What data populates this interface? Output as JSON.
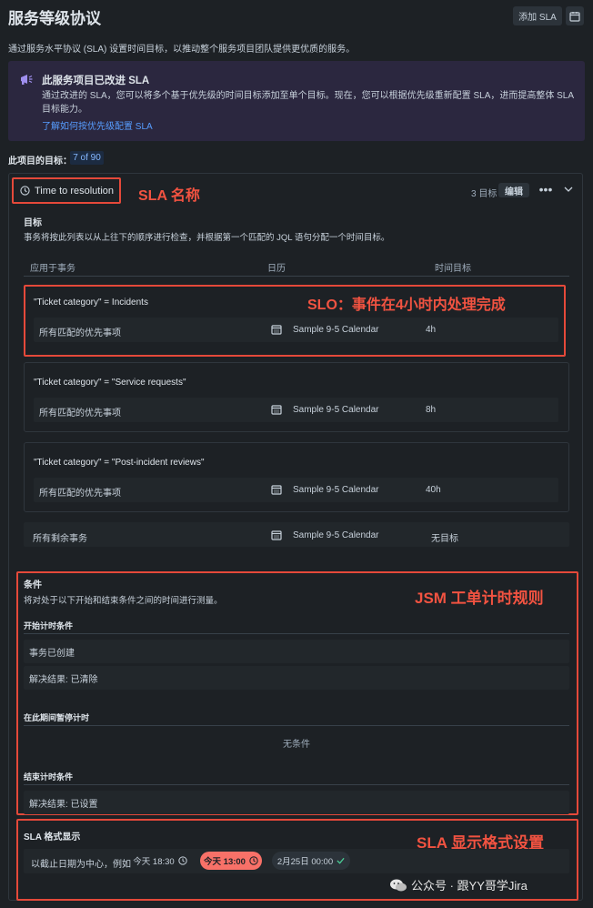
{
  "header": {
    "title": "服务等级协议",
    "add_sla_label": "添加 SLA",
    "subtitle": "通过服务水平协议 (SLA) 设置时间目标，以推动整个服务项目团队提供更优质的服务。"
  },
  "banner": {
    "title": "此服务项目已改进 SLA",
    "body": "通过改进的 SLA，您可以将多个基于优先级的时间目标添加至单个目标。现在，您可以根据优先级重新配置 SLA，进而提高整体 SLA 目标能力。",
    "link": "了解如何按优先级配置 SLA"
  },
  "goals_summary": {
    "label": "此项目的目标：",
    "count": "7 of 90"
  },
  "sla": {
    "name": "Time to resolution",
    "goals_count": "3 目标",
    "edit_label": "编辑",
    "goals_section": {
      "heading": "目标",
      "description": "事务将按此列表以从上往下的顺序进行检查，并根据第一个匹配的 JQL 语句分配一个时间目标。",
      "columns": [
        "应用于事务",
        "日历",
        "时间目标"
      ],
      "blocks": [
        {
          "jql": "\"Ticket category\" = Incidents",
          "row_label": "所有匹配的优先事项",
          "calendar": "Sample 9-5 Calendar",
          "target": "4h"
        },
        {
          "jql": "\"Ticket category\" = \"Service requests\"",
          "row_label": "所有匹配的优先事项",
          "calendar": "Sample 9-5 Calendar",
          "target": "8h"
        },
        {
          "jql": "\"Ticket category\" = \"Post-incident reviews\"",
          "row_label": "所有匹配的优先事项",
          "calendar": "Sample 9-5 Calendar",
          "target": "40h"
        }
      ],
      "remaining": {
        "label": "所有剩余事务",
        "calendar": "Sample 9-5 Calendar",
        "target": "无目标"
      }
    },
    "conditions": {
      "heading": "条件",
      "description": "将对处于以下开始和结束条件之间的时间进行测量。",
      "start_label": "开始计时条件",
      "start_items": [
        "事务已创建",
        "解决结果: 已清除"
      ],
      "pause_label": "在此期间暂停计时",
      "pause_empty": "无条件",
      "stop_label": "结束计时条件",
      "stop_items": [
        "解决结果: 已设置"
      ]
    },
    "format": {
      "heading": "SLA 格式显示",
      "option_label": "以截止日期为中心，例如",
      "example_1": "今天 18:30",
      "example_2": "今天 13:00",
      "example_3": "2月25日 00:00"
    }
  },
  "annotations": {
    "sla_name": "SLA 名称",
    "slo": "SLO：事件在4小时内处理完成",
    "jsm_rule": "JSM 工单计时规则",
    "format": "SLA 显示格式设置"
  },
  "watermark": "公众号 · 跟YY哥学Jira",
  "colors": {
    "background": "#1d2125",
    "annotation_red": "#e5493a",
    "link_blue": "#579dff",
    "banner_purple": "#2b273f",
    "overdue_pill": "#f87168"
  }
}
